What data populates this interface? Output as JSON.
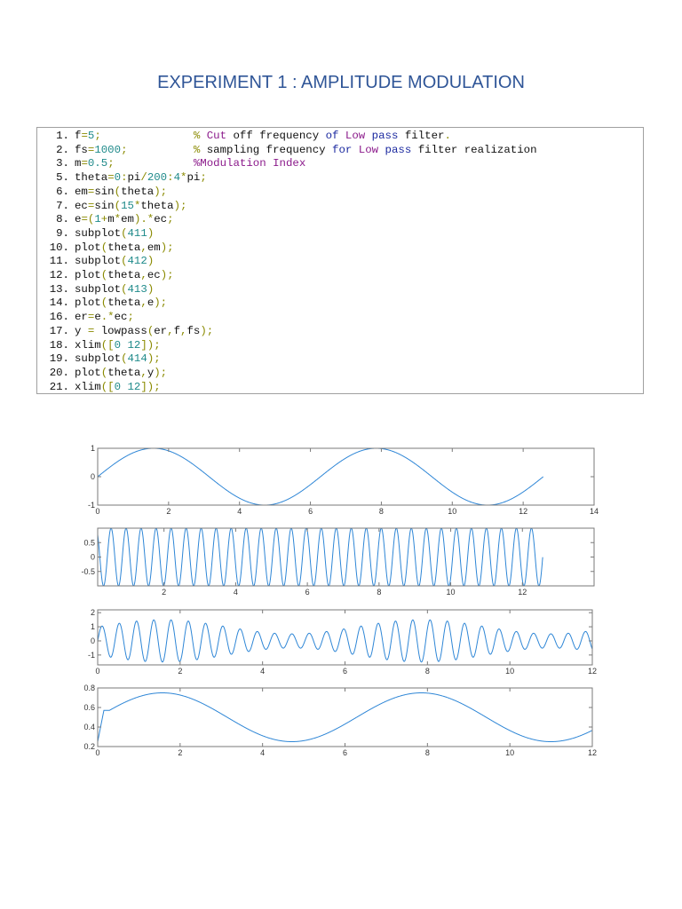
{
  "title": "EXPERIMENT 1 : AMPLITUDE MODULATION",
  "code": {
    "lines": [
      {
        "num": "1.",
        "tokens": [
          [
            "f",
            "t"
          ],
          [
            "=",
            "p"
          ],
          [
            "5",
            "n"
          ],
          [
            ";",
            "p"
          ],
          [
            "              ",
            "t"
          ],
          [
            "%",
            "p"
          ],
          [
            " ",
            "t"
          ],
          [
            "Cut",
            "c"
          ],
          [
            " off frequency ",
            "t"
          ],
          [
            "of",
            "k"
          ],
          [
            " ",
            "t"
          ],
          [
            "Low",
            "c"
          ],
          [
            " ",
            "t"
          ],
          [
            "pass",
            "k"
          ],
          [
            " filter",
            "t"
          ],
          [
            ".",
            "p"
          ]
        ]
      },
      {
        "num": "2.",
        "tokens": [
          [
            "fs",
            "t"
          ],
          [
            "=",
            "p"
          ],
          [
            "1000",
            "n"
          ],
          [
            ";",
            "p"
          ],
          [
            "          ",
            "t"
          ],
          [
            "%",
            "p"
          ],
          [
            " sampling frequency ",
            "t"
          ],
          [
            "for",
            "k"
          ],
          [
            " ",
            "t"
          ],
          [
            "Low",
            "c"
          ],
          [
            " ",
            "t"
          ],
          [
            "pass",
            "k"
          ],
          [
            " filter realization",
            "t"
          ]
        ]
      },
      {
        "num": "3.",
        "tokens": [
          [
            "m",
            "t"
          ],
          [
            "=",
            "p"
          ],
          [
            "0.5",
            "n"
          ],
          [
            ";",
            "p"
          ],
          [
            "            ",
            "t"
          ],
          [
            "%Modulation Index",
            "c"
          ]
        ]
      },
      {
        "num": "5.",
        "tokens": [
          [
            "theta",
            "t"
          ],
          [
            "=",
            "p"
          ],
          [
            "0",
            "n"
          ],
          [
            ":",
            "p"
          ],
          [
            "pi",
            "t"
          ],
          [
            "/",
            "p"
          ],
          [
            "200",
            "n"
          ],
          [
            ":",
            "p"
          ],
          [
            "4",
            "n"
          ],
          [
            "*",
            "p"
          ],
          [
            "pi",
            "t"
          ],
          [
            ";",
            "p"
          ]
        ]
      },
      {
        "num": "6.",
        "tokens": [
          [
            "em",
            "t"
          ],
          [
            "=",
            "p"
          ],
          [
            "sin",
            "t"
          ],
          [
            "(",
            "p"
          ],
          [
            "theta",
            "t"
          ],
          [
            ");",
            "p"
          ]
        ]
      },
      {
        "num": "7.",
        "tokens": [
          [
            "ec",
            "t"
          ],
          [
            "=",
            "p"
          ],
          [
            "sin",
            "t"
          ],
          [
            "(",
            "p"
          ],
          [
            "15",
            "n"
          ],
          [
            "*",
            "p"
          ],
          [
            "theta",
            "t"
          ],
          [
            ");",
            "p"
          ]
        ]
      },
      {
        "num": "8.",
        "tokens": [
          [
            "e",
            "t"
          ],
          [
            "=(",
            "p"
          ],
          [
            "1",
            "n"
          ],
          [
            "+",
            "p"
          ],
          [
            "m",
            "t"
          ],
          [
            "*",
            "p"
          ],
          [
            "em",
            "t"
          ],
          [
            ").*",
            "p"
          ],
          [
            "ec",
            "t"
          ],
          [
            ";",
            "p"
          ]
        ]
      },
      {
        "num": "9.",
        "tokens": [
          [
            "subplot",
            "t"
          ],
          [
            "(",
            "p"
          ],
          [
            "411",
            "n"
          ],
          [
            ")",
            "p"
          ]
        ]
      },
      {
        "num": "10.",
        "tokens": [
          [
            "plot",
            "t"
          ],
          [
            "(",
            "p"
          ],
          [
            "theta",
            "t"
          ],
          [
            ",",
            "p"
          ],
          [
            "em",
            "t"
          ],
          [
            ");",
            "p"
          ]
        ]
      },
      {
        "num": "11.",
        "tokens": [
          [
            "subplot",
            "t"
          ],
          [
            "(",
            "p"
          ],
          [
            "412",
            "n"
          ],
          [
            ")",
            "p"
          ]
        ]
      },
      {
        "num": "12.",
        "tokens": [
          [
            "plot",
            "t"
          ],
          [
            "(",
            "p"
          ],
          [
            "theta",
            "t"
          ],
          [
            ",",
            "p"
          ],
          [
            "ec",
            "t"
          ],
          [
            ");",
            "p"
          ]
        ]
      },
      {
        "num": "13.",
        "tokens": [
          [
            "subplot",
            "t"
          ],
          [
            "(",
            "p"
          ],
          [
            "413",
            "n"
          ],
          [
            ")",
            "p"
          ]
        ]
      },
      {
        "num": "14.",
        "tokens": [
          [
            "plot",
            "t"
          ],
          [
            "(",
            "p"
          ],
          [
            "theta",
            "t"
          ],
          [
            ",",
            "p"
          ],
          [
            "e",
            "t"
          ],
          [
            ");",
            "p"
          ]
        ]
      },
      {
        "num": "16.",
        "tokens": [
          [
            "er",
            "t"
          ],
          [
            "=",
            "p"
          ],
          [
            "e",
            "t"
          ],
          [
            ".*",
            "p"
          ],
          [
            "ec",
            "t"
          ],
          [
            ";",
            "p"
          ]
        ]
      },
      {
        "num": "17.",
        "tokens": [
          [
            "y ",
            "t"
          ],
          [
            "=",
            "p"
          ],
          [
            " lowpass",
            "t"
          ],
          [
            "(",
            "p"
          ],
          [
            "er",
            "t"
          ],
          [
            ",",
            "p"
          ],
          [
            "f",
            "t"
          ],
          [
            ",",
            "p"
          ],
          [
            "fs",
            "t"
          ],
          [
            ");",
            "p"
          ]
        ]
      },
      {
        "num": "18.",
        "tokens": [
          [
            "xlim",
            "t"
          ],
          [
            "([",
            "p"
          ],
          [
            "0 12",
            "n"
          ],
          [
            "]);",
            "p"
          ]
        ]
      },
      {
        "num": "19.",
        "tokens": [
          [
            "subplot",
            "t"
          ],
          [
            "(",
            "p"
          ],
          [
            "414",
            "n"
          ],
          [
            ");",
            "p"
          ]
        ]
      },
      {
        "num": "20.",
        "tokens": [
          [
            "plot",
            "t"
          ],
          [
            "(",
            "p"
          ],
          [
            "theta",
            "t"
          ],
          [
            ",",
            "p"
          ],
          [
            "y",
            "t"
          ],
          [
            ");",
            "p"
          ]
        ]
      },
      {
        "num": "21.",
        "tokens": [
          [
            "xlim",
            "t"
          ],
          [
            "([",
            "p"
          ],
          [
            "0 12",
            "n"
          ],
          [
            "]);",
            "p"
          ]
        ]
      }
    ]
  },
  "colors": {
    "line": "#2e86d6",
    "axis": "#7a7a7a"
  },
  "chart_data": [
    {
      "type": "line",
      "name": "message-signal",
      "formula": "sin(theta)",
      "xlim": [
        0,
        14
      ],
      "ylim": [
        -1,
        1
      ],
      "xticks": [
        "0",
        "2",
        "4",
        "6",
        "8",
        "10",
        "12",
        "14"
      ],
      "xtick_values": [
        0,
        2,
        4,
        6,
        8,
        10,
        12,
        14
      ],
      "yticks": [
        "-1",
        "0",
        "1"
      ],
      "ytick_values": [
        -1,
        0,
        1
      ],
      "x_range": [
        0,
        12.566
      ],
      "amplitude": 1,
      "frequency": 1
    },
    {
      "type": "line",
      "name": "carrier-signal",
      "formula": "sin(15*theta)",
      "xlim": [
        0.15,
        14
      ],
      "ylim": [
        -1,
        1
      ],
      "xticks": [
        "2",
        "4",
        "6",
        "8",
        "10",
        "12"
      ],
      "xtick_values": [
        2,
        4,
        6,
        8,
        10,
        12
      ],
      "yticks": [
        "0.5",
        "0",
        "-0.5"
      ],
      "ytick_values": [
        0.5,
        0,
        -0.5
      ],
      "x_range": [
        0,
        12.566
      ],
      "carrier_frequency": 15
    },
    {
      "type": "line",
      "name": "am-signal",
      "formula": "(1+0.5*sin(theta)).*sin(15*theta)",
      "xlim": [
        0,
        12
      ],
      "ylim": [
        -1.7,
        2.2
      ],
      "xticks": [
        "0",
        "2",
        "4",
        "6",
        "8",
        "10",
        "12"
      ],
      "xtick_values": [
        0,
        2,
        4,
        6,
        8,
        10,
        12
      ],
      "yticks": [
        "2",
        "1",
        "0",
        "-1"
      ],
      "ytick_values": [
        2,
        1,
        0,
        -1
      ],
      "x_range": [
        0,
        12.566
      ],
      "modulation_index": 0.5,
      "carrier_frequency": 15
    },
    {
      "type": "line",
      "name": "demodulated-signal",
      "formula": "lowpass(e.*ec,5,1000)",
      "xlim": [
        0,
        12
      ],
      "ylim": [
        0.2,
        0.8
      ],
      "xticks": [
        "0",
        "2",
        "4",
        "6",
        "8",
        "10",
        "12"
      ],
      "xtick_values": [
        0,
        2,
        4,
        6,
        8,
        10,
        12
      ],
      "yticks": [
        "0.8",
        "0.6",
        "0.4",
        "0.2"
      ],
      "ytick_values": [
        0.8,
        0.6,
        0.4,
        0.2
      ],
      "x_range": [
        0,
        12.566
      ],
      "offset": 0.5,
      "amplitude": 0.25
    }
  ]
}
